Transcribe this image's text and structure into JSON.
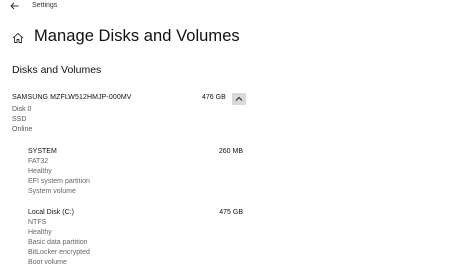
{
  "window": {
    "title": "Settings"
  },
  "header": {
    "title": "Manage Disks and Volumes"
  },
  "section": {
    "title": "Disks and Volumes"
  },
  "disk": {
    "name": "SAMSUNG MZFLW512HMJP-000MV",
    "size": "476 GB",
    "details": [
      "Disk 0",
      "SSD",
      "Online"
    ],
    "expanded": true
  },
  "volumes": [
    {
      "name": "SYSTEM",
      "size": "260 MB",
      "details": [
        "FAT32",
        "Healthy",
        "EFI system partition",
        "System volume"
      ]
    },
    {
      "name": "Local Disk (C:)",
      "size": "475 GB",
      "details": [
        "NTFS",
        "Healthy",
        "Basic data partition",
        "BitLocker encrypted",
        "Boot volume"
      ]
    }
  ],
  "icons": {
    "back": "back-arrow-icon",
    "home": "home-icon",
    "collapse": "chevron-up-icon"
  }
}
